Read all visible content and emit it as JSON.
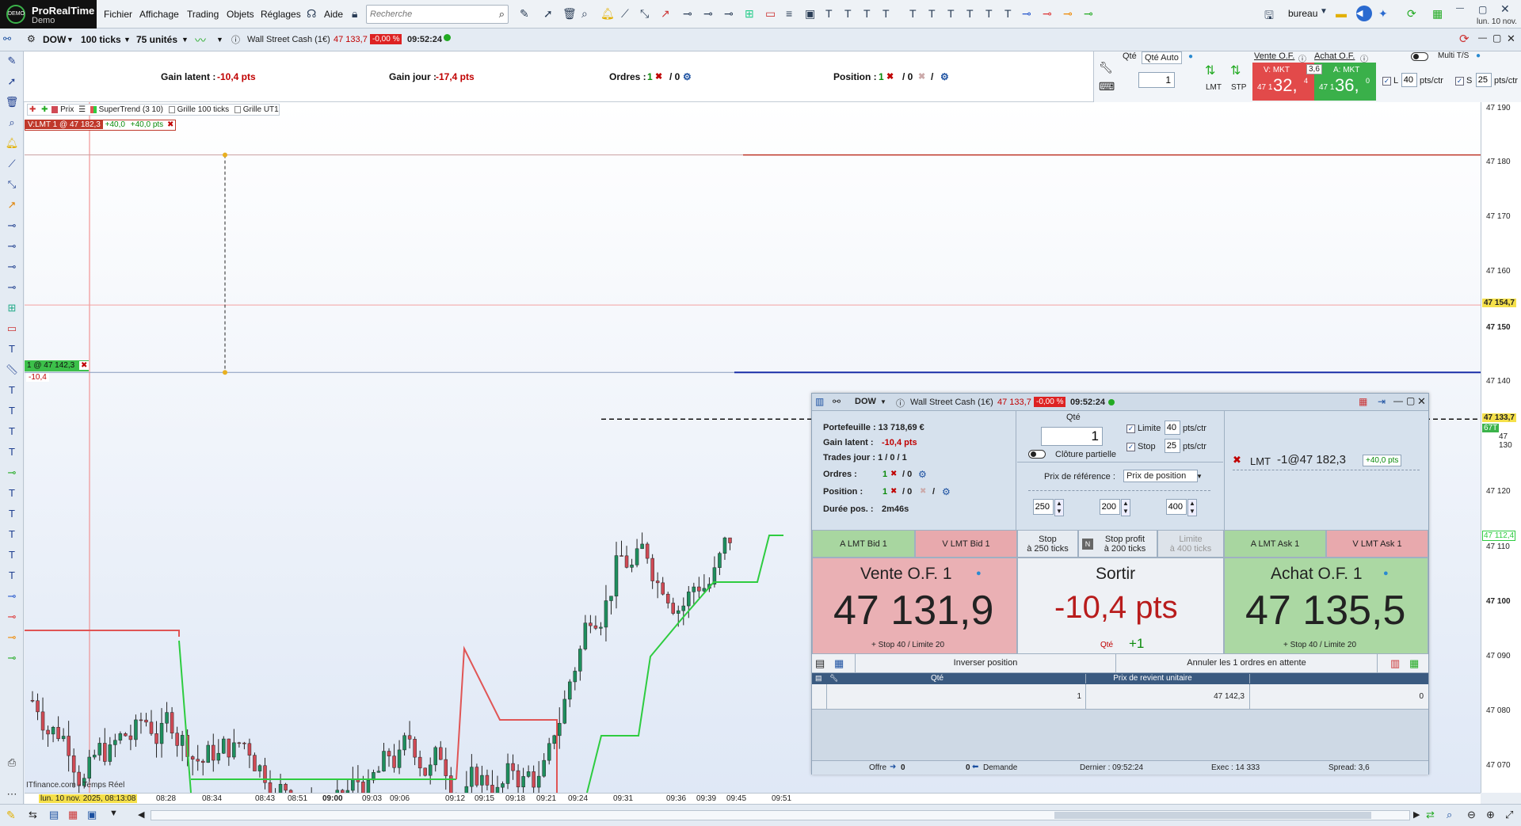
{
  "app": {
    "name": "ProRealTime",
    "mode": "Demo",
    "badge": "DEMO"
  },
  "menu": [
    "Fichier",
    "Affichage",
    "Trading",
    "Objets",
    "Réglages",
    "Aide"
  ],
  "search": {
    "placeholder": "Recherche"
  },
  "workspace": "bureau",
  "date_top": "lun. 10 nov.",
  "chart_toolbar": {
    "instrument": "DOW",
    "ticks": "100 ticks",
    "units": "75 unités",
    "title": "Wall Street Cash (1€)",
    "price": "47 133,7",
    "change": "-0,00 %",
    "time": "09:52:24"
  },
  "info": {
    "gain_latent_label": "Gain latent :",
    "gain_latent": "-10,4 pts",
    "gain_jour_label": "Gain jour :",
    "gain_jour": "-17,4 pts",
    "ordres_label": "Ordres :",
    "ordres_a": "1",
    "ordres_b": "/ 0",
    "position_label": "Position :",
    "position_a": "1",
    "position_b": "/ 0",
    "position_c": "/"
  },
  "top_panel": {
    "qte_label": "Qté",
    "qte_auto": "Qté Auto",
    "qty": "1",
    "lmt": "LMT",
    "stp": "STP",
    "vente_of": "Vente O.F.",
    "achat_of": "Achat O.F.",
    "v_mkt": "V: MKT",
    "a_mkt": "A: MKT",
    "spread": "3,6",
    "v_price_small": "47 1",
    "v_price_big": "32,",
    "v_price_sup": "4",
    "a_price_small": "47 1",
    "a_price_big": "36,",
    "a_price_sup": "0",
    "multi": "Multi T/S",
    "l_label": "L",
    "l_value": "40",
    "s_label": "S",
    "s_value": "25",
    "pts_ctr": "pts/ctr"
  },
  "legend": {
    "prix": "Prix",
    "supertrend": "SuperTrend (3 10)",
    "grille100": "Grille 100 ticks",
    "grilleut1": "Grille UT1"
  },
  "orders_on_chart": {
    "sell_order": "V:LMT 1 @ 47 182,3",
    "sell_pnl1": "+40,0",
    "sell_pnl2": "+40,0  pts",
    "position": "1 @ 47 142,3",
    "position_pnl": "-10,4"
  },
  "y_axis": [
    "47 190",
    "47 180",
    "47 170",
    "47 160",
    "47 154,7",
    "47 150",
    "47 140",
    "47 133,7",
    "67T",
    "47 130",
    "47 120",
    "47 112,4",
    "47 110",
    "47 100",
    "47 090",
    "47 080",
    "47 070"
  ],
  "x_axis": [
    "lun. 10 nov. 2025, 08:13:08",
    "08:28",
    "08:34",
    "08:43",
    "08:51",
    "09:00",
    "09:03",
    "09:06",
    "09:12",
    "09:15",
    "09:18",
    "09:21",
    "09:24",
    "09:31",
    "09:36",
    "09:39",
    "09:45",
    "09:51"
  ],
  "chart_source": "ITfinance.com - Temps Réel",
  "panel": {
    "instrument": "DOW",
    "title": "Wall Street Cash (1€)",
    "price": "47 133,7",
    "change": "-0,00 %",
    "time": "09:52:24",
    "portefeuille": "Portefeuille : 13 718,69 €",
    "gain_label": "Gain latent :",
    "gain": "-10,4 pts",
    "trades": "Trades jour : 1 / 0 / 1",
    "ordres_label": "Ordres :",
    "ordres": "1",
    "ordres_b": "/ 0",
    "position_label": "Position :",
    "position": "1",
    "position_b": "/ 0",
    "position_c": "/",
    "duree_label": "Durée pos. :",
    "duree": "2m46s",
    "qte_label": "Qté",
    "qty": "1",
    "cloture": "Clôture partielle",
    "limite_label": "Limite",
    "limite_val": "40",
    "stop_label": "Stop",
    "stop_val": "25",
    "pts_ctr": "pts/ctr",
    "prix_ref_label": "Prix de référence :",
    "prix_ref": "Prix de position",
    "step1": "250",
    "step2": "200",
    "step3": "400",
    "lmt_order_label": "LMT",
    "lmt_order": "-1@47 182,3",
    "lmt_pnl": "+40,0 pts",
    "btn_a_lmt_bid": "A LMT Bid 1",
    "btn_v_lmt_bid": "V LMT Bid 1",
    "btn_stop1": "Stop",
    "btn_stop2": "à 250 ticks",
    "btn_sp1": "Stop profit",
    "btn_sp2": "à 200 ticks",
    "btn_lim1": "Limite",
    "btn_lim2": "à 400 ticks",
    "btn_a_lmt_ask": "A LMT Ask 1",
    "btn_v_lmt_ask": "V LMT Ask 1",
    "vente_label": "Vente O.F. 1",
    "vente_price": "47 131,9",
    "vente_sub": "+ Stop 40 / Limite 20",
    "sortir_label": "Sortir",
    "sortir_value": "-10,4 pts",
    "sortir_qte": "Qté",
    "sortir_qty": "+1",
    "achat_label": "Achat O.F. 1",
    "achat_price": "47 135,5",
    "achat_sub": "+ Stop 40 / Limite 20",
    "inverser": "Inverser position",
    "annuler": "Annuler les 1 ordres en attente",
    "table_headers": [
      "Qté",
      "Prix de revient unitaire",
      ""
    ],
    "table_row": [
      "1",
      "47 142,3",
      "0"
    ],
    "footer_offre": "Offre",
    "footer_offre_v": "0",
    "footer_dem_v": "0",
    "footer_demande": "Demande",
    "footer_dernier": "Dernier :  09:52:24",
    "footer_exec": "Exec :  14 333",
    "footer_spread": "Spread:  3,6"
  },
  "colors": {
    "bid": "#e8a9ad",
    "ask": "#a8d6a0",
    "bullish": "#1e8f5e",
    "bearish": "#d04a55",
    "supertrend_up": "#2ecc40",
    "supertrend_down": "#e05555",
    "position_line": "#1a2ea8",
    "order_line": "#c0392b"
  },
  "chart_data": {
    "type": "candlestick",
    "instrument": "Wall Street Cash (1€)",
    "ylim": [
      47065,
      47192
    ],
    "current_price": 47133.7,
    "position_price": 47142.3,
    "sell_limit_price": 47182.3,
    "alert_price": 47154.7
  }
}
